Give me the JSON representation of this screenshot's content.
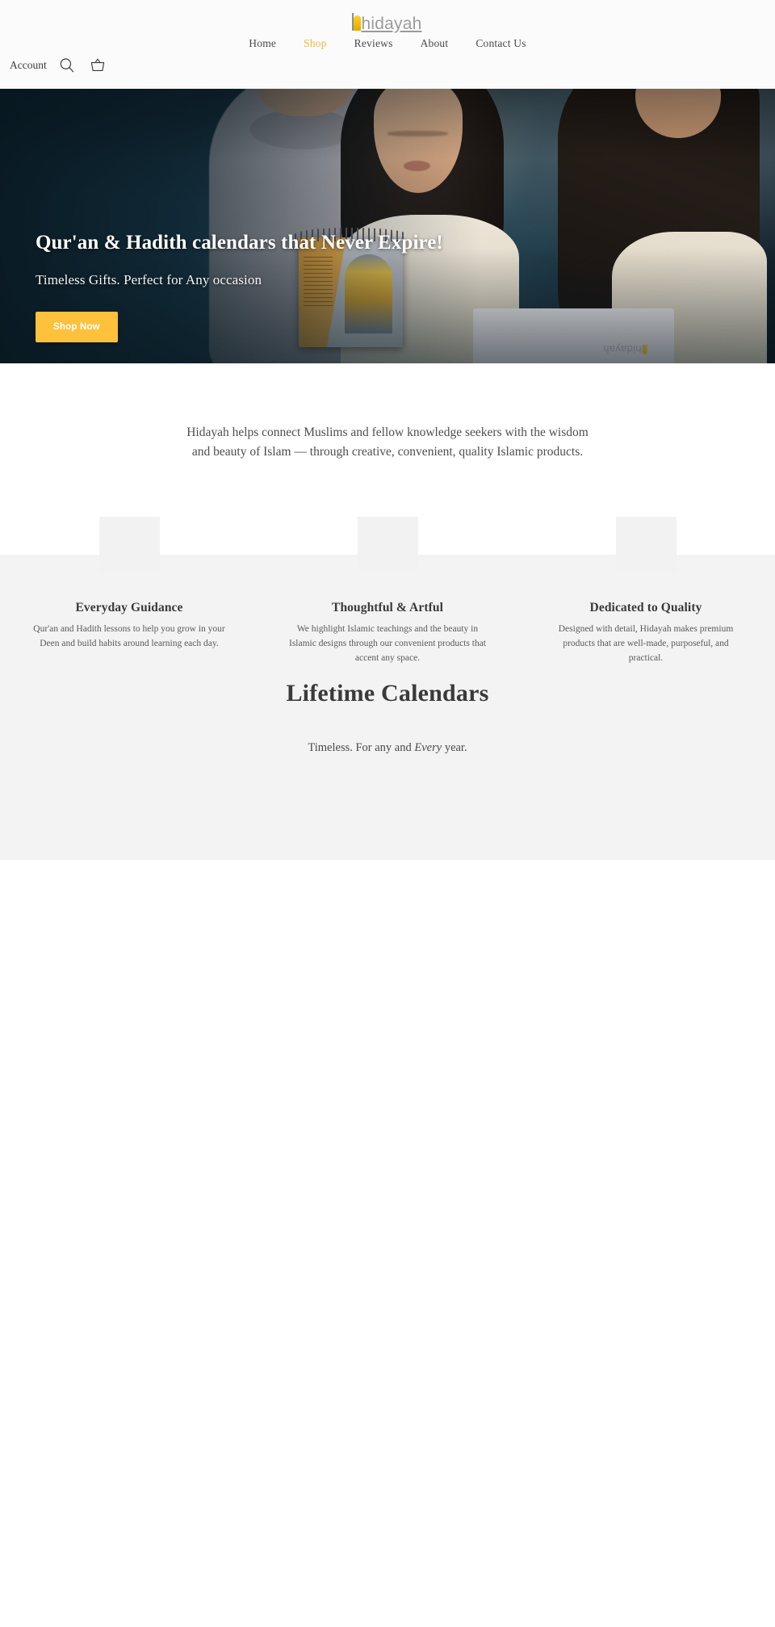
{
  "header": {
    "logo": {
      "text": "hidayah",
      "icon": "arch-logo-icon",
      "accent_color": "#f4c430"
    },
    "nav": [
      {
        "label": "Home",
        "active": false
      },
      {
        "label": "Shop",
        "active": true
      },
      {
        "label": "Reviews",
        "active": false
      },
      {
        "label": "About",
        "active": false
      },
      {
        "label": "Contact Us",
        "active": false
      }
    ],
    "utils": {
      "account_label": "Account",
      "search_icon": "search-icon",
      "cart_icon": "shopping-basket-icon"
    },
    "active_color": "#e8b94a"
  },
  "hero": {
    "title": "Qur'an & Hadith calendars that Never Expire!",
    "subtitle": "Timeless Gifts. Perfect for Any occasion",
    "cta_label": "Shop Now",
    "cta_color": "#fdc13c",
    "watermark": "hidayah"
  },
  "intro": {
    "paragraph": "Hidayah helps connect Muslims and fellow knowledge seekers with the wisdom and beauty of Islam — through creative, convenient, quality Islamic products."
  },
  "features": [
    {
      "title": "Everyday Guidance",
      "body": "Qur'an and Hadith lessons to help you grow in your Deen and build habits around learning each day.",
      "image": "feature-image-placeholder"
    },
    {
      "title": "Thoughtful & Artful",
      "body": "We highlight Islamic teachings and the beauty in Islamic designs through our convenient products that accent any space.",
      "image": "feature-image-placeholder"
    },
    {
      "title": "Dedicated to Quality",
      "body": "Designed with detail, Hidayah makes premium products that are well-made, purposeful, and practical.",
      "image": "feature-image-placeholder"
    }
  ],
  "lifetime": {
    "title": "Lifetime Calendars",
    "subtitle_pre": "Timeless. For any and ",
    "subtitle_em": "Every",
    "subtitle_post": " year."
  }
}
